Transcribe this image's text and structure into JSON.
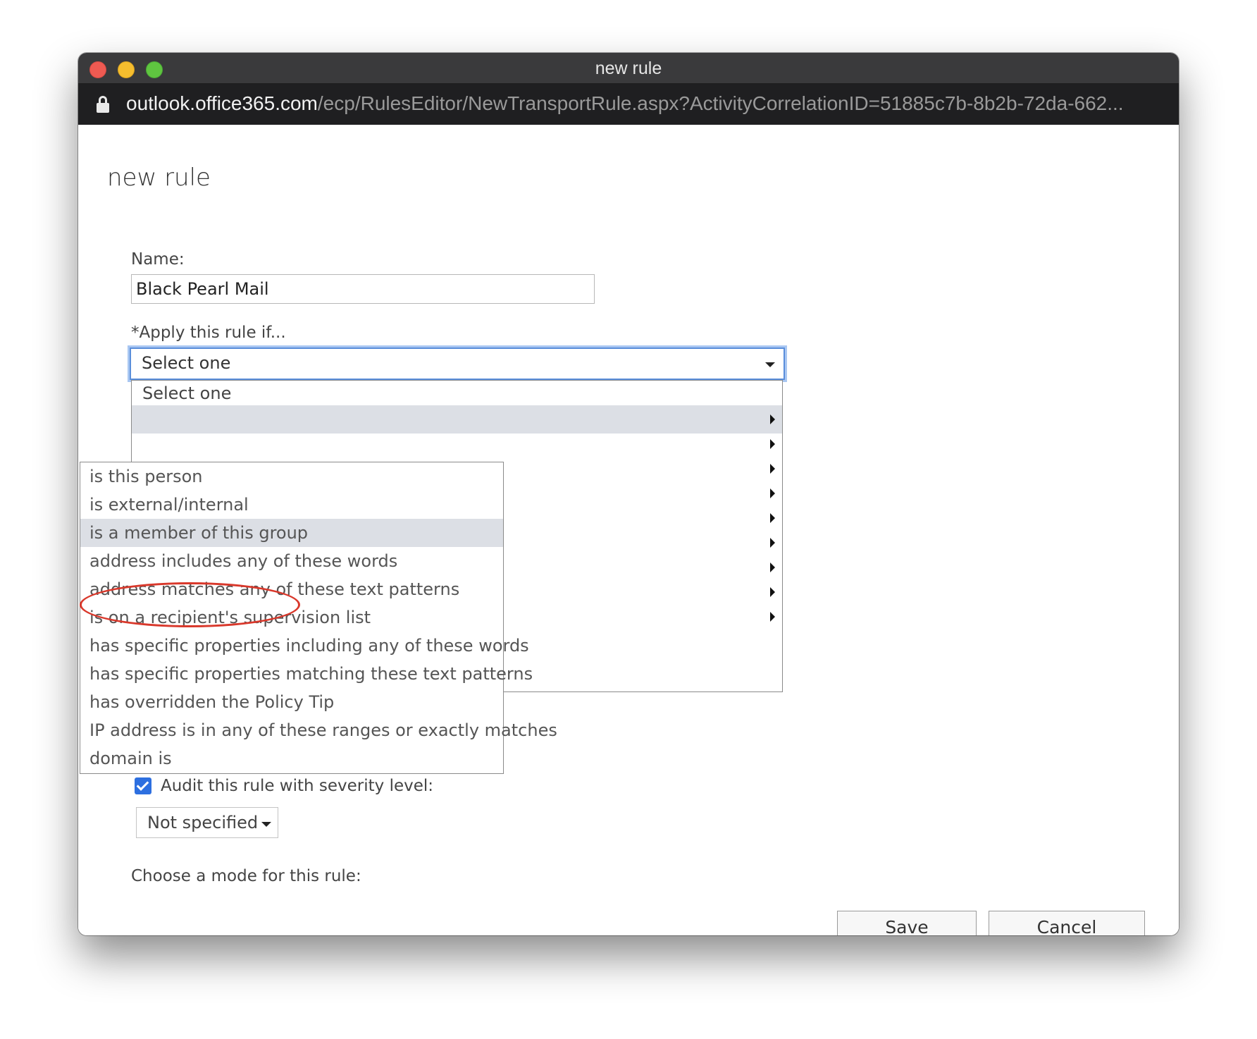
{
  "window": {
    "title": "new rule",
    "url_host": "outlook.office365.com",
    "url_path": "/ecp/RulesEditor/NewTransportRule.aspx?ActivityCorrelationID=51885c7b-8b2b-72da-662..."
  },
  "page": {
    "title": "new rule"
  },
  "form": {
    "name_label": "Name:",
    "name_value": "Black Pearl Mail",
    "apply_label": "*Apply this rule if...",
    "apply_selected": "Select one",
    "apply_options": {
      "first": "Select one"
    },
    "submenu": [
      "is this person",
      "is external/internal",
      "is a member of this group",
      "address includes any of these words",
      "address matches any of these text patterns",
      "is on a recipient's supervision list",
      "has specific properties including any of these words",
      "has specific properties matching these text patterns",
      "has overridden the Policy Tip",
      "IP address is in any of these ranges or exactly matches",
      "domain is"
    ],
    "submenu_highlighted_index": 2,
    "audit_checked": true,
    "audit_label": "Audit this rule with severity level:",
    "severity_value": "Not specified",
    "mode_label": "Choose a mode for this rule:"
  },
  "buttons": {
    "save": "Save",
    "cancel": "Cancel"
  },
  "colors": {
    "focus_border": "#5a8edb",
    "checkbox": "#2d6fe0",
    "highlight_row": "#dcdfe5",
    "annotation_ellipse": "#d9382b"
  }
}
